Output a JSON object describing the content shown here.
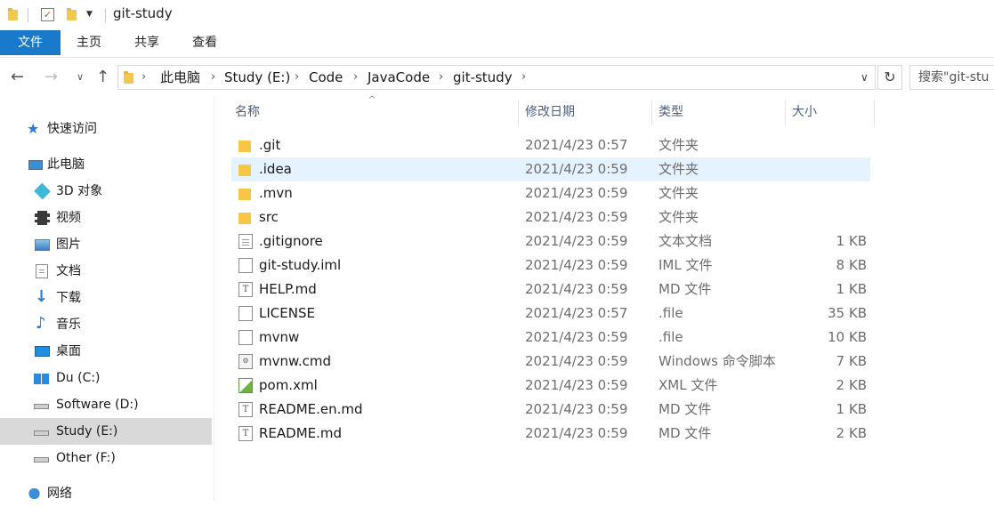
{
  "window": {
    "title": "git-study"
  },
  "ribbon": {
    "tabs": [
      "文件",
      "主页",
      "共享",
      "查看"
    ]
  },
  "address": {
    "crumbs": [
      "此电脑",
      "Study (E:)",
      "Code",
      "JavaCode",
      "git-study"
    ],
    "search_placeholder": "搜索\"git-stu"
  },
  "sidebar": {
    "items": [
      {
        "label": "快速访问",
        "icon": "star-icon"
      },
      {
        "label": "此电脑",
        "icon": "computer-icon"
      },
      {
        "label": "3D 对象",
        "icon": "cube-icon"
      },
      {
        "label": "视频",
        "icon": "film-icon"
      },
      {
        "label": "图片",
        "icon": "picture-icon"
      },
      {
        "label": "文档",
        "icon": "document-icon"
      },
      {
        "label": "下载",
        "icon": "download-arrow-icon"
      },
      {
        "label": "音乐",
        "icon": "music-note-icon"
      },
      {
        "label": "桌面",
        "icon": "desktop-icon"
      },
      {
        "label": "Du (C:)",
        "icon": "windows-drive-icon"
      },
      {
        "label": "Software (D:)",
        "icon": "drive-icon"
      },
      {
        "label": "Study (E:)",
        "icon": "drive-icon",
        "selected": true
      },
      {
        "label": "Other (F:)",
        "icon": "drive-icon"
      },
      {
        "label": "网络",
        "icon": "network-icon"
      }
    ]
  },
  "columns": {
    "name": "名称",
    "date": "修改日期",
    "type": "类型",
    "size": "大小"
  },
  "files": [
    {
      "name": ".git",
      "date": "2021/4/23 0:57",
      "type": "文件夹",
      "size": "",
      "icon": "folder-icon"
    },
    {
      "name": ".idea",
      "date": "2021/4/23 0:59",
      "type": "文件夹",
      "size": "",
      "icon": "folder-icon",
      "selected": true
    },
    {
      "name": ".mvn",
      "date": "2021/4/23 0:59",
      "type": "文件夹",
      "size": "",
      "icon": "folder-icon"
    },
    {
      "name": "src",
      "date": "2021/4/23 0:59",
      "type": "文件夹",
      "size": "",
      "icon": "folder-icon"
    },
    {
      "name": ".gitignore",
      "date": "2021/4/23 0:59",
      "type": "文本文档",
      "size": "1 KB",
      "icon": "text-file-icon"
    },
    {
      "name": "git-study.iml",
      "date": "2021/4/23 0:59",
      "type": "IML 文件",
      "size": "8 KB",
      "icon": "blank-file-icon"
    },
    {
      "name": "HELP.md",
      "date": "2021/4/23 0:59",
      "type": "MD 文件",
      "size": "1 KB",
      "icon": "typora-file-icon"
    },
    {
      "name": "LICENSE",
      "date": "2021/4/23 0:57",
      "type": ".file",
      "size": "35 KB",
      "icon": "blank-file-icon"
    },
    {
      "name": "mvnw",
      "date": "2021/4/23 0:59",
      "type": ".file",
      "size": "10 KB",
      "icon": "blank-file-icon"
    },
    {
      "name": "mvnw.cmd",
      "date": "2021/4/23 0:59",
      "type": "Windows 命令脚本",
      "size": "7 KB",
      "icon": "cmd-file-icon"
    },
    {
      "name": "pom.xml",
      "date": "2021/4/23 0:59",
      "type": "XML 文件",
      "size": "2 KB",
      "icon": "xml-file-icon"
    },
    {
      "name": "README.en.md",
      "date": "2021/4/23 0:59",
      "type": "MD 文件",
      "size": "1 KB",
      "icon": "typora-file-icon"
    },
    {
      "name": "README.md",
      "date": "2021/4/23 0:59",
      "type": "MD 文件",
      "size": "2 KB",
      "icon": "typora-file-icon"
    }
  ]
}
